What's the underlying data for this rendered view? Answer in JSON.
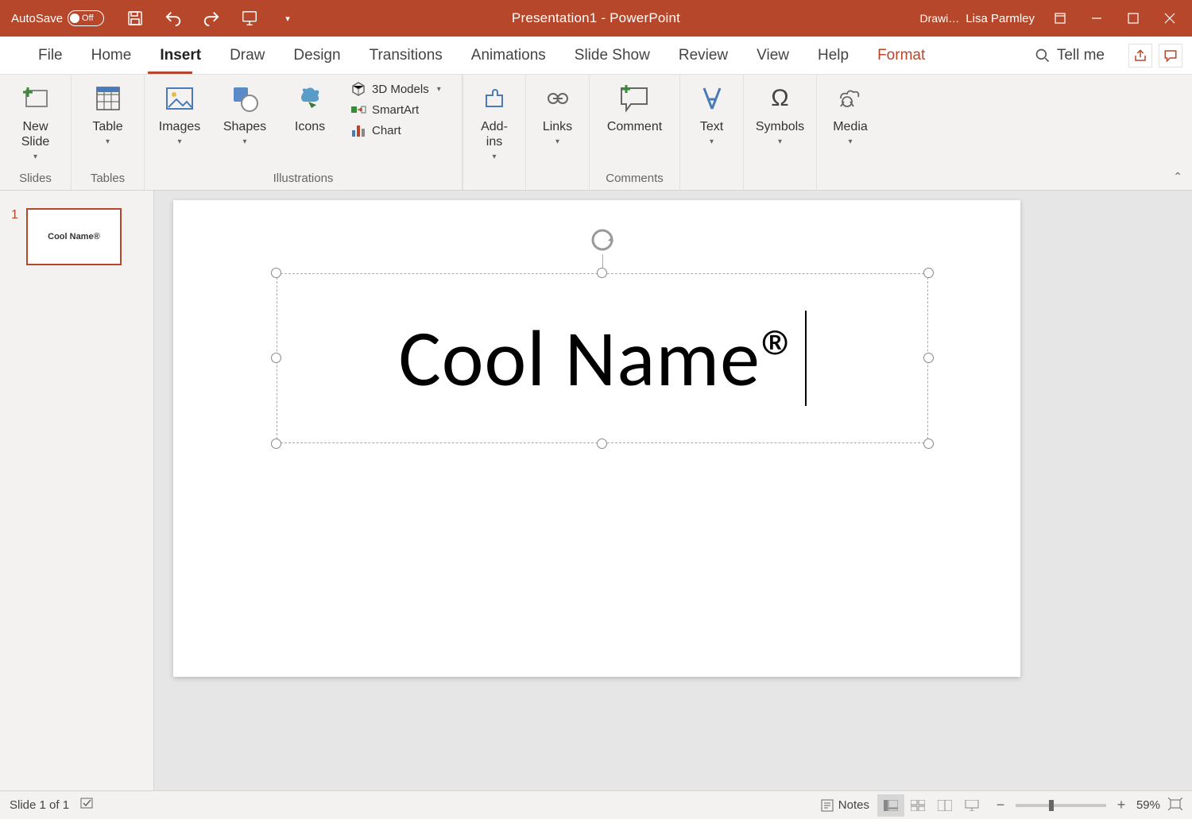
{
  "titlebar": {
    "autosave_label": "AutoSave",
    "autosave_state": "Off",
    "doc_title": "Presentation1  -  PowerPoint",
    "context_tab": "Drawi…",
    "user_name": "Lisa Parmley"
  },
  "tabs": {
    "file": "File",
    "home": "Home",
    "insert": "Insert",
    "draw": "Draw",
    "design": "Design",
    "transitions": "Transitions",
    "animations": "Animations",
    "slideshow": "Slide Show",
    "review": "Review",
    "view": "View",
    "help": "Help",
    "format": "Format",
    "tellme": "Tell me"
  },
  "ribbon": {
    "g_slides": {
      "label": "Slides",
      "new_slide": "New\nSlide"
    },
    "g_tables": {
      "label": "Tables",
      "table": "Table"
    },
    "g_illustrations": {
      "label": "Illustrations",
      "images": "Images",
      "shapes": "Shapes",
      "icons": "Icons",
      "models": "3D Models",
      "smartart": "SmartArt",
      "chart": "Chart"
    },
    "g_addins": {
      "addins": "Add-\nins"
    },
    "g_links": {
      "links": "Links"
    },
    "g_comments": {
      "label": "Comments",
      "comment": "Comment"
    },
    "g_text": {
      "text": "Text"
    },
    "g_symbols": {
      "symbols": "Symbols"
    },
    "g_media": {
      "media": "Media"
    }
  },
  "thumb": {
    "num": "1",
    "text": "Cool Name®"
  },
  "slide": {
    "title_text": "Cool Name®"
  },
  "status": {
    "slide_pos": "Slide 1 of 1",
    "notes": "Notes",
    "zoom": "59%"
  }
}
